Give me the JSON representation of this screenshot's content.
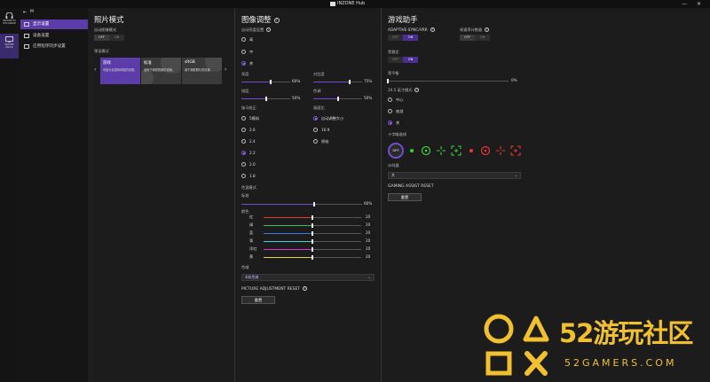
{
  "titlebar": {
    "title": "INZONE Hub",
    "minimize": "—",
    "close": "✕"
  },
  "devices": [
    {
      "line1": "INZONE H9",
      "line2": "WH-G900N"
    },
    {
      "line1": "INZONE",
      "line2": "M9/SD"
    }
  ],
  "nav": {
    "back": "M",
    "items": [
      {
        "label": "显示设置"
      },
      {
        "label": "设备设置"
      },
      {
        "label": "应用程序同步设置"
      }
    ]
  },
  "picture_mode": {
    "title": "照片模式",
    "auto_label": "自动图像模式",
    "auto_off": "OFF",
    "auto_on": "ON",
    "mode_label": "预设模式",
    "cards": [
      {
        "title": "游戏",
        "desc": "可最大化游戏体验的设置。"
      },
      {
        "title": "标准",
        "desc": "适用于观看视频的设置。"
      },
      {
        "title": "sRGB",
        "desc": "用于观看照片的设置。"
      }
    ]
  },
  "image_adjust": {
    "title": "图像调整",
    "auto_brightness": "自动亮度设置",
    "radio1": [
      {
        "label": "高"
      },
      {
        "label": "中"
      },
      {
        "label": "关"
      }
    ],
    "sliders": [
      {
        "label": "亮度",
        "value": "60%",
        "fraction": 0.6
      },
      {
        "label": "对比度",
        "value": "75%",
        "fraction": 0.75
      },
      {
        "label": "锐度",
        "value": "50%",
        "fraction": 0.5
      },
      {
        "label": "色调",
        "value": "50%",
        "fraction": 0.5
      }
    ],
    "gamma_label": "伽马校正",
    "gamma": [
      {
        "label": "5模拟"
      },
      {
        "label": "2.6"
      },
      {
        "label": "2.4"
      },
      {
        "label": "2.2"
      },
      {
        "label": "2.0"
      },
      {
        "label": "1.8"
      }
    ],
    "aspect_label": "画面比",
    "aspect": [
      {
        "label": "自动调整大小"
      },
      {
        "label": "16:9"
      },
      {
        "label": "原始"
      }
    ],
    "color_temp_label": "色温模式",
    "color_temp_sub": "标准",
    "color_temp": {
      "value": "60%",
      "fraction": 0.6
    },
    "color_label": "颜色",
    "colors": [
      {
        "label": "红",
        "value": "20",
        "color": "#e03a3a",
        "fraction": 0.5
      },
      {
        "label": "绿",
        "value": "20",
        "color": "#39c15a",
        "fraction": 0.5
      },
      {
        "label": "蓝",
        "value": "20",
        "color": "#3a7be0",
        "fraction": 0.5
      },
      {
        "label": "青",
        "value": "20",
        "color": "#3ad6d6",
        "fraction": 0.5
      },
      {
        "label": "洋红",
        "value": "20",
        "color": "#d83ad0",
        "fraction": 0.5
      },
      {
        "label": "黄",
        "value": "20",
        "color": "#e0d83a",
        "fraction": 0.5
      }
    ],
    "color_space_label": "色域",
    "color_space_value": "本机色域",
    "reset_title": "PICTURE ADJUSTMENT RESET",
    "reset_button": "重置"
  },
  "game_assist": {
    "title": "游戏助手",
    "vrr_label": "ADAPTIVE-SYNC/VRR",
    "vrr_off": "OFF",
    "vrr_on": "ON",
    "fps_label": "帧速率计数器",
    "fps_off": "OFF",
    "fps_on": "ON",
    "blacklevel_label": "黑稳定",
    "blacklevel_off": "OFF",
    "blacklevel_on": "ON",
    "black_eq_label": "黑平衡",
    "black_eq": {
      "value": "0%",
      "fraction": 0.0
    },
    "mode245_label": "24.5 英寸模式",
    "mode245": [
      {
        "label": "中心"
      },
      {
        "label": "底部"
      },
      {
        "label": "关"
      }
    ],
    "crosshair_label": "十字瞄准线",
    "crosshair_off": "OFF",
    "timer_label": "计时器",
    "timer_value": "关",
    "reset_title": "GAMING ASSIST RESET",
    "reset_button": "重置"
  },
  "watermark": {
    "text": "52游玩社区",
    "sub": "52GAMERS.COM"
  }
}
